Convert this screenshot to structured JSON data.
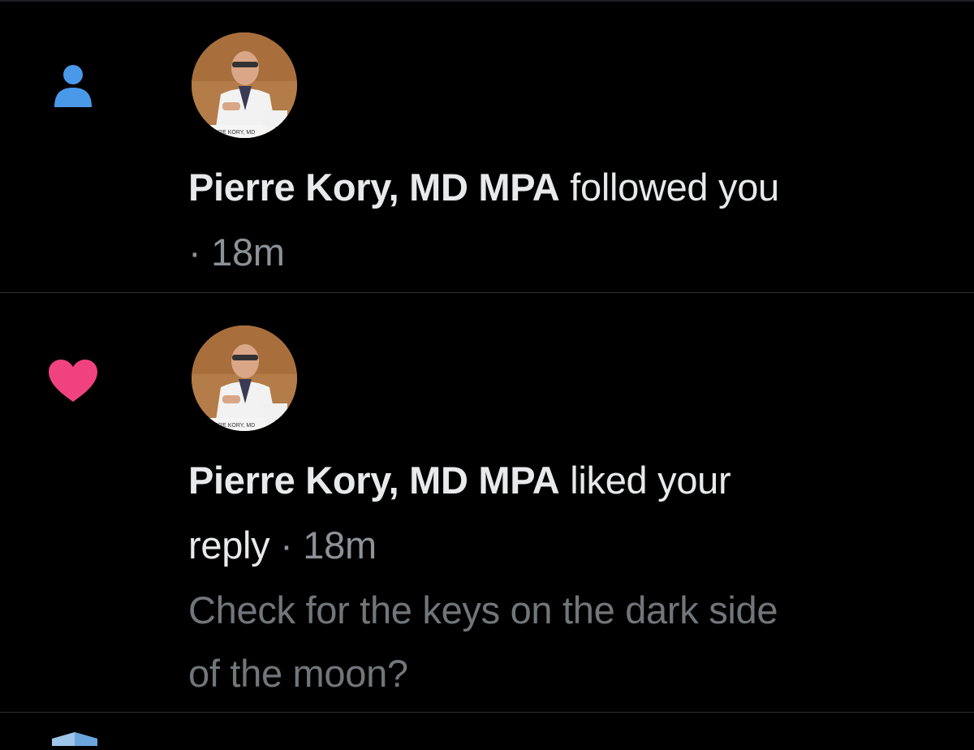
{
  "notifications": [
    {
      "type": "follow",
      "icon": "person-icon",
      "icon_color": "#4a99e9",
      "user_name": "Pierre Kory, MD MPA",
      "action": "followed you",
      "separator": "·",
      "time": "18m",
      "avatar_caption": "RRE KORY, MD"
    },
    {
      "type": "like",
      "icon": "heart-icon",
      "icon_color": "#f0427f",
      "user_name": "Pierre Kory, MD MPA",
      "action_line1": "liked your",
      "action_line2": "reply",
      "separator": "·",
      "time": "18m",
      "quoted_line1": "Check for the keys on the dark side",
      "quoted_line2": "of the moon?",
      "avatar_caption": "RRE KORY, MD"
    }
  ],
  "next_notification_icon": "shield-icon",
  "colors": {
    "background": "#000000",
    "primary_text": "#e7e9ea",
    "secondary_text": "#71767b",
    "divider": "#2f3336"
  }
}
